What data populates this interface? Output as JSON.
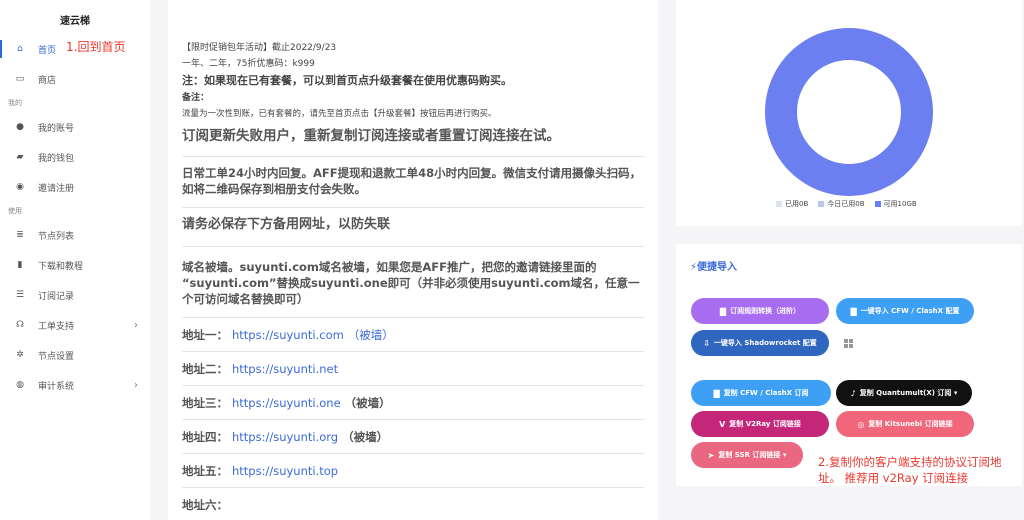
{
  "sidebar": {
    "brand": "速云梯",
    "items_top": [
      {
        "key": "home",
        "label": "首页",
        "icon": "home-icon",
        "active": true
      },
      {
        "key": "store",
        "label": "商店",
        "icon": "store-icon"
      }
    ],
    "section_mine": "我的",
    "items_mine": [
      {
        "key": "account",
        "label": "我的账号",
        "icon": "user-icon"
      },
      {
        "key": "wallet",
        "label": "我的钱包",
        "icon": "wallet-icon"
      },
      {
        "key": "invite",
        "label": "邀请注册",
        "icon": "invite-icon"
      }
    ],
    "section_use": "使用",
    "items_use": [
      {
        "key": "nodes",
        "label": "节点列表",
        "icon": "list-icon"
      },
      {
        "key": "download",
        "label": "下载和教程",
        "icon": "book-icon"
      },
      {
        "key": "sublog",
        "label": "订阅记录",
        "icon": "lines-icon"
      },
      {
        "key": "ticket",
        "label": "工单支持",
        "icon": "support-icon",
        "chevron": true
      },
      {
        "key": "nodeset",
        "label": "节点设置",
        "icon": "gear-icon"
      },
      {
        "key": "audit",
        "label": "审计系统",
        "icon": "globe-icon",
        "chevron": true
      }
    ]
  },
  "annotations": {
    "home": "1.回到首页",
    "copy": "2.复制你的客户端支持的协议订阅地址。 推荐用 v2Ray 订阅连接"
  },
  "main": {
    "promo_line1": "【限时促销包年活动】截止2022/9/23",
    "promo_line2": "一年、二年，75折优惠码：k999",
    "promo_line3": "注：如果现在已有套餐，可以到首页点升级套餐在使用优惠码购买。",
    "promo_line4": "备注：",
    "promo_line5": "流量为一次性到账，已有套餐的，请先至首页点击【升级套餐】按钮后再进行购买。",
    "sub_notice": "订阅更新失败用户，重新复制订阅连接或者重置订阅连接在试。",
    "work_notice": "日常工单24小时内回复。AFF提现和退款工单48小时内回复。微信支付请用摄像头扫码，如将二维码保存到相册支付会失败。",
    "save_notice": "请务必保存下方备用网址，以防失联",
    "domain_notice": "域名被墙。suyunti.com域名被墙，如果您是AFF推广，把您的邀请链接里面的 “suyunti.com”替换成suyunti.one即可（并非必须使用suyunti.com域名，任意一个可访问域名替换即可）",
    "addresses": [
      {
        "label": "地址一：",
        "url": "https://suyunti.com",
        "note": "（被墙）",
        "note_style": "link"
      },
      {
        "label": "地址二：",
        "url": "https://suyunti.net",
        "note": ""
      },
      {
        "label": "地址三：",
        "url": "https://suyunti.one",
        "note": "（被墙）",
        "note_style": "dark"
      },
      {
        "label": "地址四：",
        "url": "https://suyunti.org",
        "note": "（被墙）",
        "note_style": "dark"
      },
      {
        "label": "地址五：",
        "url": "https://suyunti.top",
        "note": ""
      },
      {
        "label": "地址六：",
        "url": "",
        "note": ""
      }
    ]
  },
  "chart_data": {
    "type": "pie",
    "series": [
      {
        "name": "已用",
        "value": 0,
        "display": "0B",
        "color": "#dde3f0"
      },
      {
        "name": "今日已用",
        "value": 0,
        "display": "0B",
        "color": "#b9c6ee"
      },
      {
        "name": "可用",
        "value": 10,
        "display": "10GB",
        "color": "#6b7ff0"
      }
    ]
  },
  "import": {
    "title": "便捷导入",
    "buttons": [
      {
        "key": "sub-convert",
        "label": "订阅规则转换（进阶）",
        "icon": "▇",
        "color": "#a86cf0"
      },
      {
        "key": "import-cfw",
        "label": "一键导入 CFW / ClashX 配置",
        "icon": "▇",
        "color": "#3ea0f5"
      },
      {
        "key": "import-shadowrocket",
        "label": "一键导入 Shadowrocket 配置",
        "icon": "⇩",
        "color": "#2f66c0"
      },
      {
        "key": "copy-cfw",
        "label": "复制 CFW / ClashX 订阅",
        "icon": "▇",
        "color": "#3ea0f5"
      },
      {
        "key": "copy-quantumult",
        "label": "复制 Quantumult(X) 订阅 ▾",
        "icon": "♪",
        "color": "#111111"
      },
      {
        "key": "copy-v2ray",
        "label": "复制 V2Ray 订阅链接",
        "icon": "V",
        "color": "#c4277a"
      },
      {
        "key": "copy-kitsunebi",
        "label": "复制 Kitsunebi 订阅链接",
        "icon": "◎",
        "color": "#f0667a"
      },
      {
        "key": "copy-ssr",
        "label": "复制 SSR 订阅链接 ▾",
        "icon": "➤",
        "color": "#e96780"
      }
    ]
  }
}
